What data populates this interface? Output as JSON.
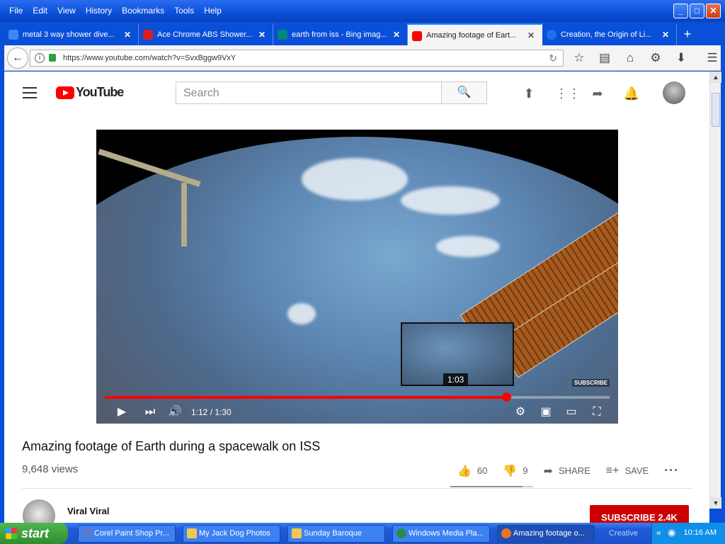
{
  "menu": [
    "File",
    "Edit",
    "View",
    "History",
    "Bookmarks",
    "Tools",
    "Help"
  ],
  "tabs": [
    {
      "label": "metal 3 way shower dive...",
      "favicon_color": "#4285f4"
    },
    {
      "label": "Ace Chrome ABS Shower...",
      "favicon_color": "#e11b22"
    },
    {
      "label": "earth from iss - Bing imag...",
      "favicon_color": "#00897b"
    },
    {
      "label": "Amazing footage of Eart...",
      "favicon_color": "#ff0000"
    },
    {
      "label": "Creation, the Origin of Li...",
      "favicon_color": "#1a73e8"
    }
  ],
  "url": "https://www.youtube.com/watch?v=SvxBggw9VxY",
  "search": {
    "placeholder": "Search"
  },
  "player": {
    "time": "1:12 / 1:30",
    "hover_time": "1:03",
    "progress": 0.795,
    "subscribe_watermark": "SUBSCRIBE"
  },
  "video": {
    "title": "Amazing footage of Earth during a spacewalk on ISS",
    "views": "9,648 views",
    "likes": "60",
    "dislikes": "9",
    "like_ratio": 0.87,
    "share": "SHARE",
    "save": "SAVE"
  },
  "channel": {
    "name": "Viral Viral",
    "subscribe": "SUBSCRIBE 2.4K"
  },
  "taskbar": {
    "start": "start",
    "items": [
      "Corel Paint Shop Pr...",
      "My Jack Dog Photos",
      "Sunday Baroque",
      "Windows Media Pla...",
      "Amazing footage o..."
    ],
    "creative": "Creative",
    "clock": "10:16 AM"
  }
}
